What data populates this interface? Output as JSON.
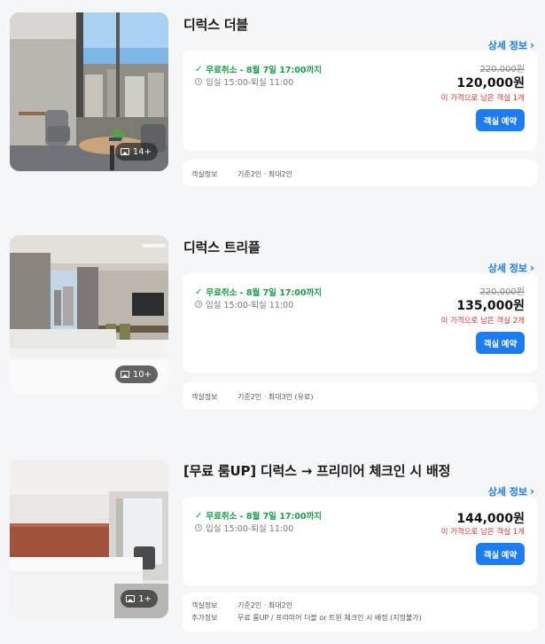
{
  "rooms": [
    {
      "name": "디럭스 더블",
      "detail_label": "상세 정보",
      "photo_count": "14+",
      "policy": "무료취소 - 8월 7일 17:00까지",
      "checkin": "입실 15:00-퇴실 11:00",
      "original_price": "220,000원",
      "price": "120,000원",
      "remaining": "이 가격으로 남은 객실 1개",
      "book_label": "객실 예약",
      "info": [
        {
          "key": "객실정보",
          "value": "기준2인 · 최대2인"
        }
      ]
    },
    {
      "name": "디럭스 트리플",
      "detail_label": "상세 정보",
      "photo_count": "10+",
      "policy": "무료취소 - 8월 7일 17:00까지",
      "checkin": "입실 15:00-퇴실 11:00",
      "original_price": "220,000원",
      "price": "135,000원",
      "remaining": "이 가격으로 남은 객실 2개",
      "book_label": "객실 예약",
      "info": [
        {
          "key": "객실정보",
          "value": "기준2인 · 최대3인 (유료)"
        }
      ]
    },
    {
      "name": "[무료 룸UP] 디럭스 → 프리미어 체크인 시 배정",
      "detail_label": "상세 정보",
      "photo_count": "1+",
      "policy": "무료취소 - 8월 7일 17:00까지",
      "checkin": "입실 15:00-퇴실 11:00",
      "original_price": "",
      "price": "144,000원",
      "remaining": "이 가격으로 남은 객실 1개",
      "book_label": "객실 예약",
      "info": [
        {
          "key": "객실정보",
          "value": "기준2인 · 최대2인"
        },
        {
          "key": "추가정보",
          "value": "무료 룸UP / 프리미어 더블 or 트윈 체크인 시 배정 (지정불가)"
        }
      ]
    }
  ],
  "icons": {
    "photo": "image-icon",
    "check": "check-icon",
    "clock": "clock-icon",
    "chevron": "chevron-right-icon"
  },
  "colors": {
    "accent": "#1c7cf0",
    "policy_green": "#1a9e4b",
    "remaining_red": "#e5322d",
    "background": "#f5f6f8"
  }
}
